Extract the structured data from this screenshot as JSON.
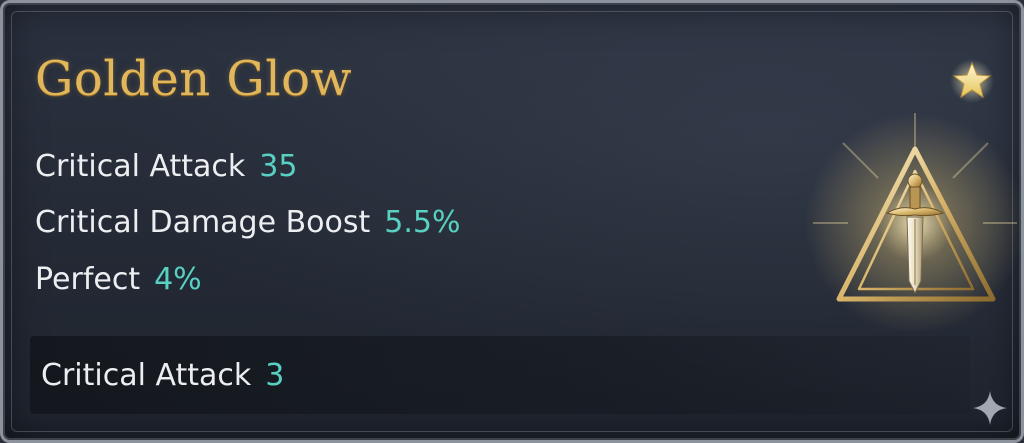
{
  "item": {
    "name": "Golden Glow"
  },
  "stats": [
    {
      "label": "Critical Attack",
      "value": "35"
    },
    {
      "label": "Critical Damage Boost",
      "value": "5.5%"
    },
    {
      "label": "Perfect",
      "value": "4%"
    }
  ],
  "bonus": {
    "label": "Critical Attack",
    "value": "3"
  },
  "icons": {
    "emblem": "triangle-sword-emblem-icon",
    "favorite": "star-icon",
    "sparkle": "sparkle-icon"
  },
  "colors": {
    "title": "#e2b65a",
    "stat_value": "#58d1c2",
    "stat_label": "#eceef1",
    "background": "#242a35"
  }
}
